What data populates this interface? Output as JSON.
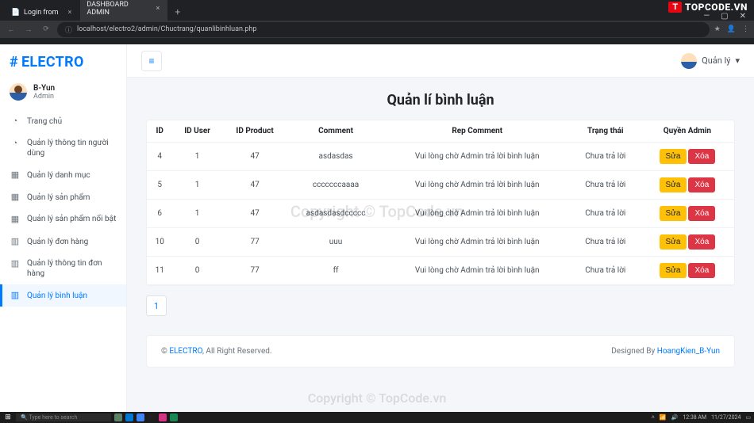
{
  "browser": {
    "tabs": [
      {
        "title": "Login from"
      },
      {
        "title": "DASHBOARD ADMIN"
      }
    ],
    "url": "localhost/electro2/admin/Chuctrang/quanlibinhluan.php"
  },
  "brand": "ELECTRO",
  "user": {
    "name": "B-Yun",
    "role": "Admin"
  },
  "sidebar": {
    "items": [
      {
        "label": "Trang chủ"
      },
      {
        "label": "Quản lý thông tin người dùng"
      },
      {
        "label": "Quản lý danh mục"
      },
      {
        "label": "Quản lý sản phẩm"
      },
      {
        "label": "Quản lý sản phẩm nổi bật"
      },
      {
        "label": "Quản lý đơn hàng"
      },
      {
        "label": "Quản lý thông tin đơn hàng"
      },
      {
        "label": "Quản lý bình luận"
      }
    ]
  },
  "topbar": {
    "user_label": "Quản lý"
  },
  "page_title": "Quản lí bình luận",
  "table": {
    "headers": [
      "ID",
      "ID User",
      "ID Product",
      "Comment",
      "Rep Comment",
      "Trạng thái",
      "Quyền Admin"
    ],
    "actions": {
      "edit": "Sửa",
      "delete": "Xóa"
    },
    "rows": [
      {
        "id": "4",
        "id_user": "1",
        "id_product": "47",
        "comment": "asdasdas",
        "rep": "Vui lòng chờ Admin trả lời bình luận",
        "status": "Chưa trả lời"
      },
      {
        "id": "5",
        "id_user": "1",
        "id_product": "47",
        "comment": "cccccccaaaa",
        "rep": "Vui lòng chờ Admin trả lời bình luận",
        "status": "Chưa trả lời"
      },
      {
        "id": "6",
        "id_user": "1",
        "id_product": "47",
        "comment": "asdasdasdccccc",
        "rep": "Vui lòng chờ Admin trả lời bình luận",
        "status": "Chưa trả lời"
      },
      {
        "id": "10",
        "id_user": "0",
        "id_product": "77",
        "comment": "uuu",
        "rep": "Vui lòng chờ Admin trả lời bình luận",
        "status": "Chưa trả lời"
      },
      {
        "id": "11",
        "id_user": "0",
        "id_product": "77",
        "comment": "ff",
        "rep": "Vui lòng chờ Admin trả lời bình luận",
        "status": "Chưa trả lời"
      }
    ]
  },
  "pagination": {
    "current": "1"
  },
  "footer": {
    "copyright_prefix": "© ",
    "brand": "ELECTRO",
    "copyright_suffix": ", All Right Reserved.",
    "designed_prefix": "Designed By ",
    "designer": "HoangKien_B-Yun"
  },
  "taskbar": {
    "search_placeholder": "Type here to search",
    "time": "12:38 AM",
    "date": "11/27/2024"
  },
  "watermark": {
    "badge": "T",
    "text": "TOPCODE.VN",
    "center": "Copyright © TopCode.vn",
    "bottom": "Copyright © TopCode.vn"
  }
}
